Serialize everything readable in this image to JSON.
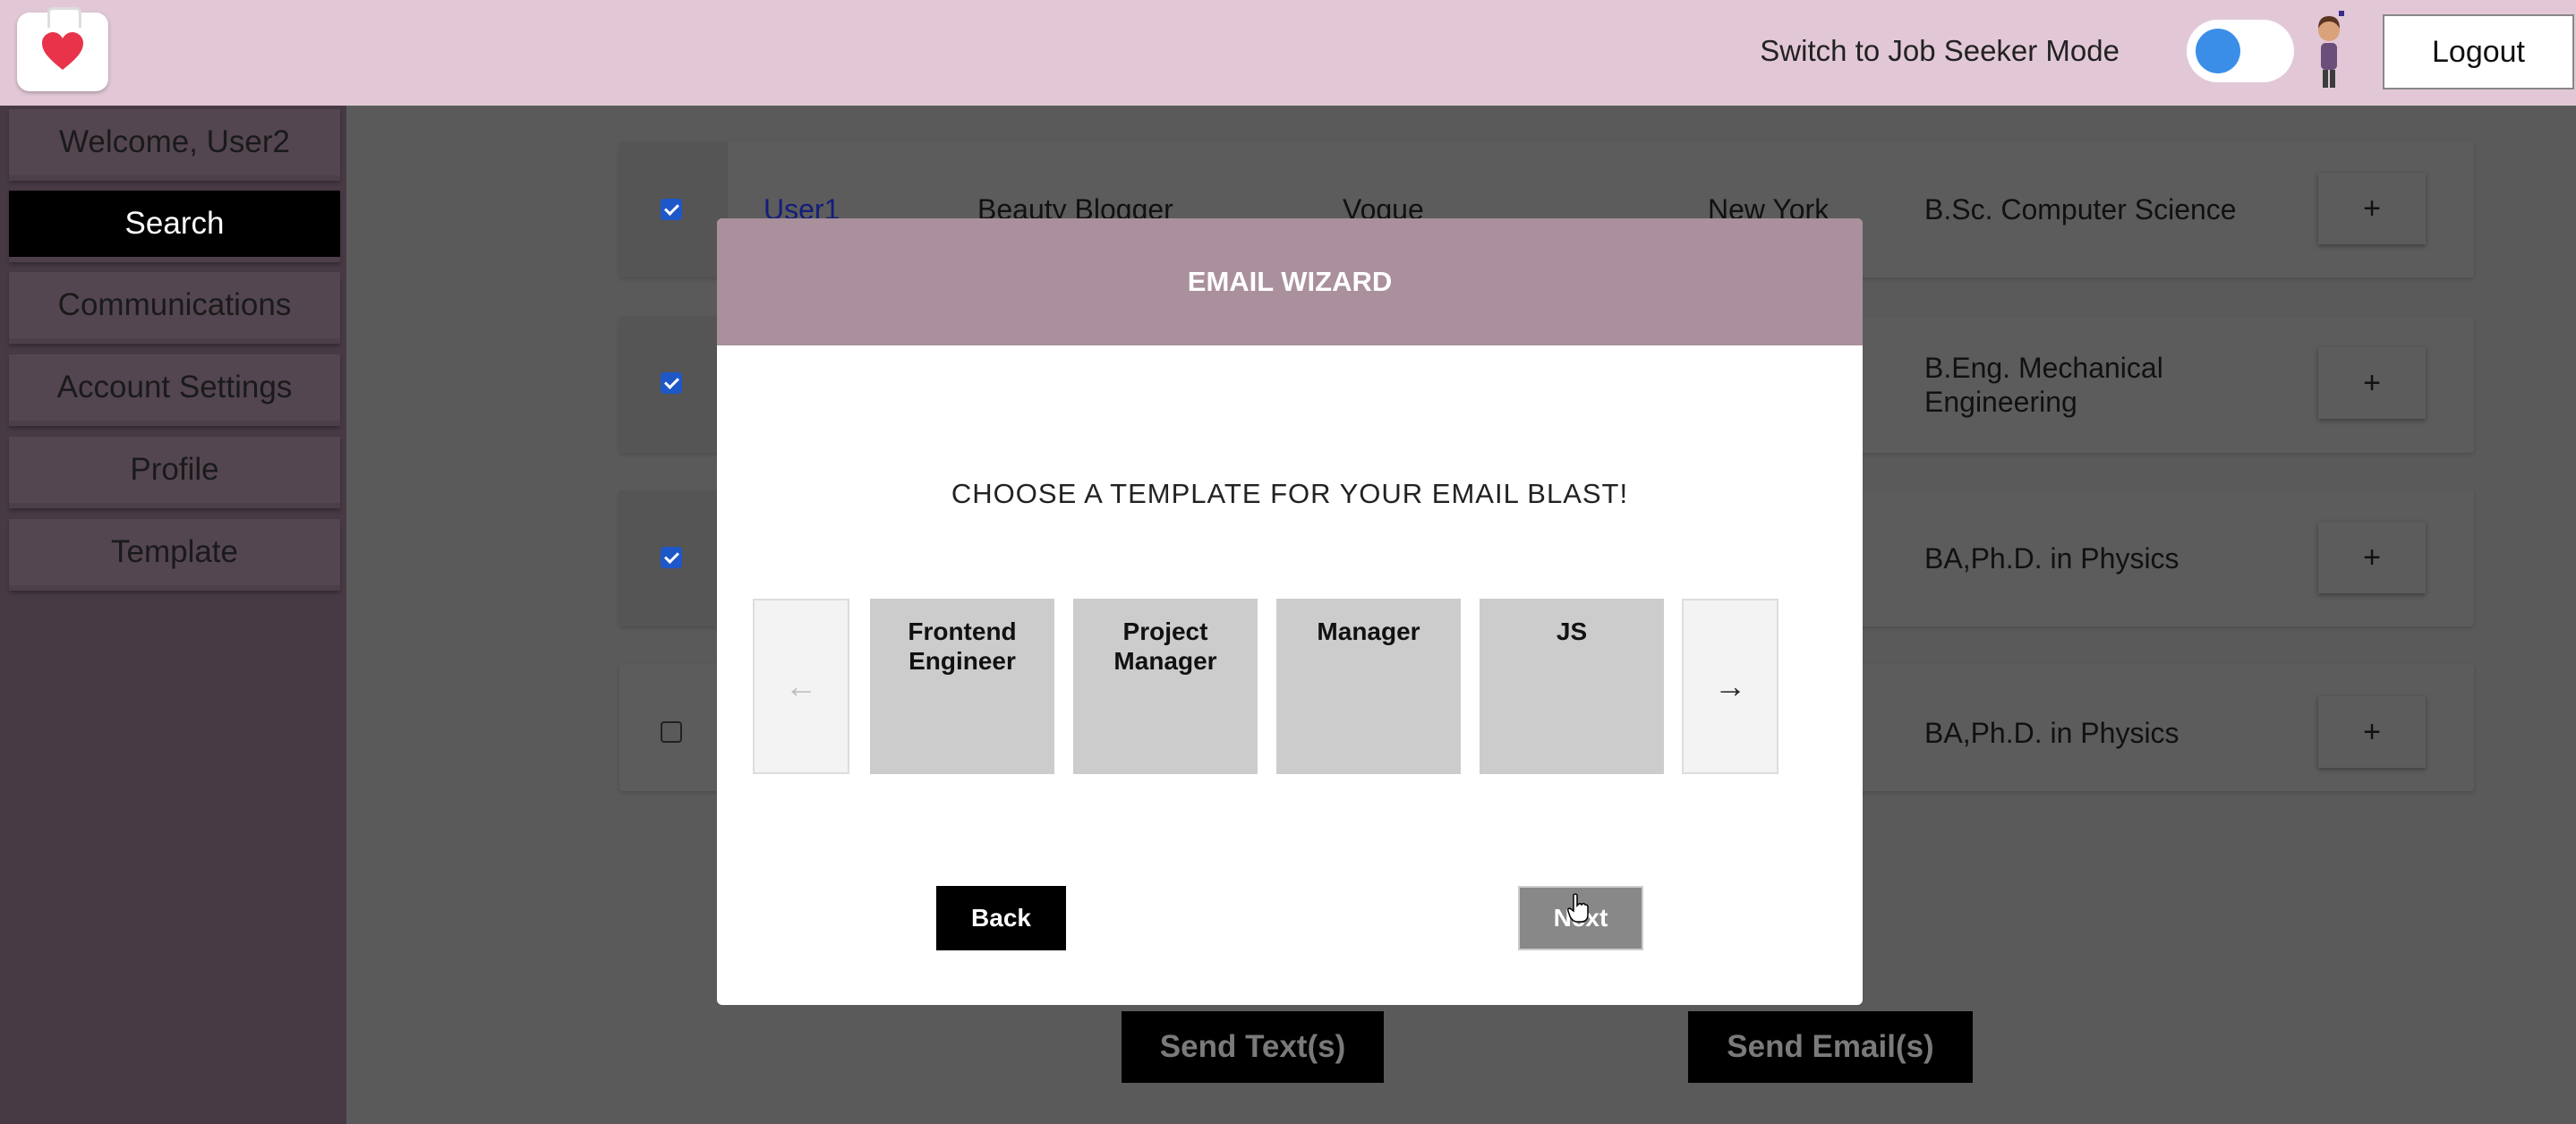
{
  "header": {
    "mode_label": "Switch to Job Seeker Mode",
    "logout_label": "Logout",
    "accent_color": "#e2c8d6",
    "toggle_color": "#3b8ee8"
  },
  "sidebar": {
    "items": [
      {
        "label": "Welcome, User2",
        "active": false
      },
      {
        "label": "Search",
        "active": true
      },
      {
        "label": "Communications",
        "active": false
      },
      {
        "label": "Account Settings",
        "active": false
      },
      {
        "label": "Profile",
        "active": false
      },
      {
        "label": "Template",
        "active": false
      }
    ]
  },
  "results": {
    "rows": [
      {
        "checked": true,
        "name": "User1",
        "title": "Beauty Blogger",
        "company": "Vogue",
        "location": "New York",
        "education": "B.Sc. Computer Science"
      },
      {
        "checked": true,
        "education": "B.Eng. Mechanical Engineering"
      },
      {
        "checked": true,
        "education": "BA,Ph.D. in Physics"
      },
      {
        "checked": false,
        "education": "BA,Ph.D. in Physics"
      }
    ],
    "add_label": "+"
  },
  "modal": {
    "title": "EMAIL WIZARD",
    "prompt": "CHOOSE A TEMPLATE FOR YOUR EMAIL BLAST!",
    "prev_arrow": "←",
    "next_arrow": "→",
    "templates": [
      "Frontend Engineer",
      "Project Manager",
      "Manager",
      "JS"
    ],
    "back_label": "Back",
    "next_label": "Next"
  },
  "actions": {
    "send_text_label": "Send Text(s)",
    "send_email_label": "Send Email(s)"
  }
}
